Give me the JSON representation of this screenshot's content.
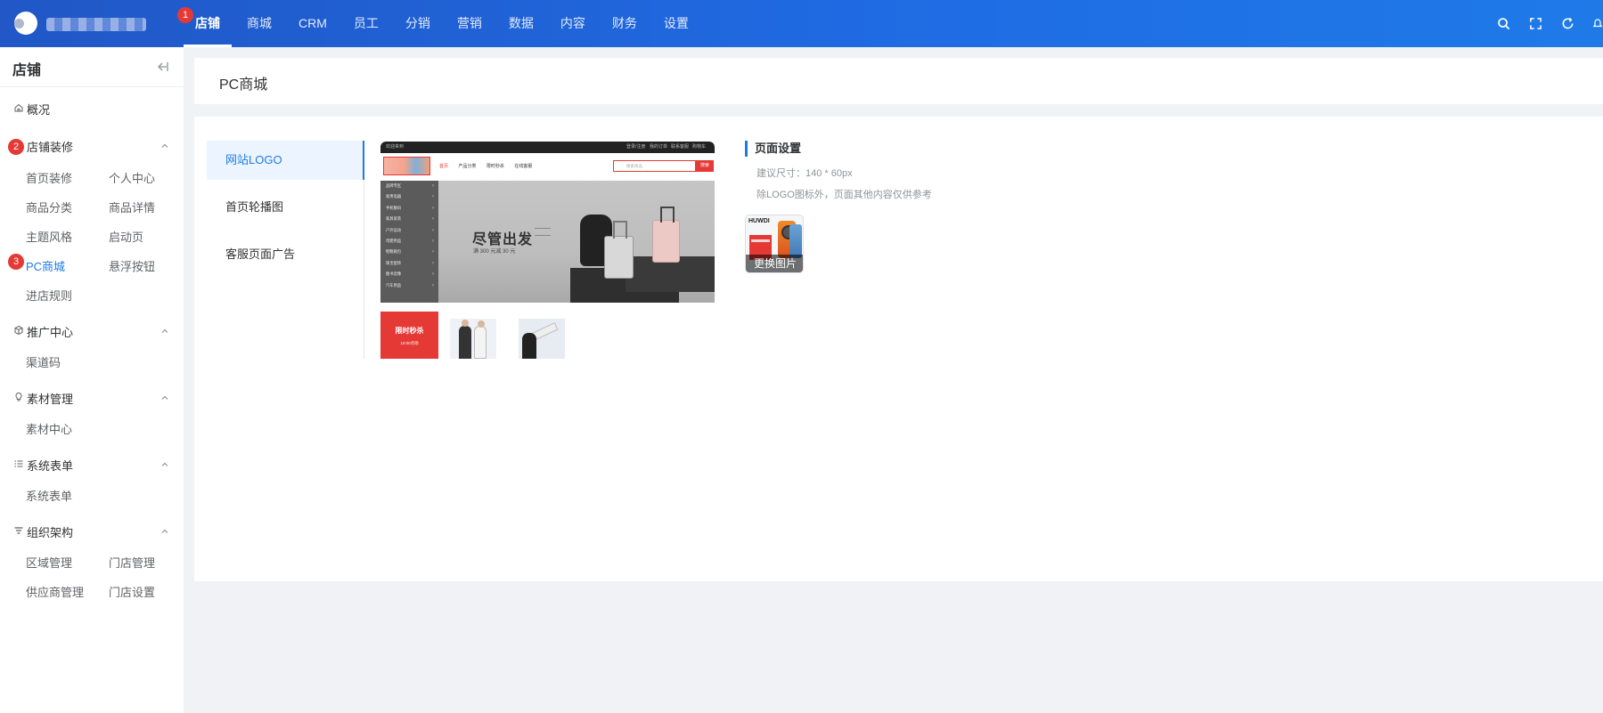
{
  "topbar": {
    "brand_text": "多 统",
    "nav": [
      {
        "label": "店铺",
        "active": true,
        "step": "1"
      },
      {
        "label": "商城"
      },
      {
        "label": "CRM"
      },
      {
        "label": "员工"
      },
      {
        "label": "分销"
      },
      {
        "label": "营销"
      },
      {
        "label": "数据"
      },
      {
        "label": "内容"
      },
      {
        "label": "财务"
      },
      {
        "label": "设置"
      }
    ],
    "icons": [
      "search-icon",
      "fullscreen-icon",
      "refresh-icon",
      "notification-icon"
    ]
  },
  "sidebar": {
    "title": "店铺",
    "collapse_icon": "collapse-left-icon",
    "overview": {
      "label": "概况",
      "icon": "home-icon"
    },
    "groups": [
      {
        "label": "店铺装修",
        "icon": "brush-icon",
        "step": "2",
        "items": [
          "首页装修",
          "个人中心",
          "商品分类",
          "商品详情",
          "主题风格",
          "启动页",
          "PC商城",
          "悬浮按钮",
          "进店规则"
        ]
      },
      {
        "label": "推广中心",
        "icon": "cube-icon",
        "items": [
          "渠道码"
        ]
      },
      {
        "label": "素材管理",
        "icon": "bulb-icon",
        "items": [
          "素材中心"
        ]
      },
      {
        "label": "系统表单",
        "icon": "list-icon",
        "items": [
          "系统表单"
        ]
      },
      {
        "label": "组织架构",
        "icon": "filter-icon",
        "items": [
          "区域管理",
          "门店管理",
          "供应商管理",
          "门店设置"
        ]
      }
    ],
    "active_item": "PC商城",
    "active_step": "3"
  },
  "page": {
    "title": "PC商城"
  },
  "settings_nav": [
    "网站LOGO",
    "首页轮播图",
    "客服页面广告"
  ],
  "preview": {
    "topbar_left": "欢迎来到",
    "topbar_right": [
      "登录/注册",
      "我的订单",
      "联系客服",
      "购物车"
    ],
    "links": [
      "首页",
      "产品分类",
      "限时秒杀",
      "在线客服"
    ],
    "search_placeholder": "搜索商品",
    "search_button": "搜索",
    "categories": [
      "品牌专区",
      "家用电器",
      "手机数码",
      "家具家装",
      "户外运动",
      "母婴用品",
      "鞋靴箱包",
      "珠宝配饰",
      "图书音像",
      "汽车用品"
    ],
    "banner_title": "尽管出发",
    "banner_subtitle": "满 300 元减 30 元",
    "flash_title": "限时秒杀",
    "flash_time": "16:00点场"
  },
  "page_settings": {
    "title": "页面设置",
    "hint_size": "建议尺寸：140 * 60px",
    "hint_note": "除LOGO图标外，页面其他内容仅供参考",
    "thumb_brand": "HUWDI",
    "change_image": "更换图片"
  }
}
